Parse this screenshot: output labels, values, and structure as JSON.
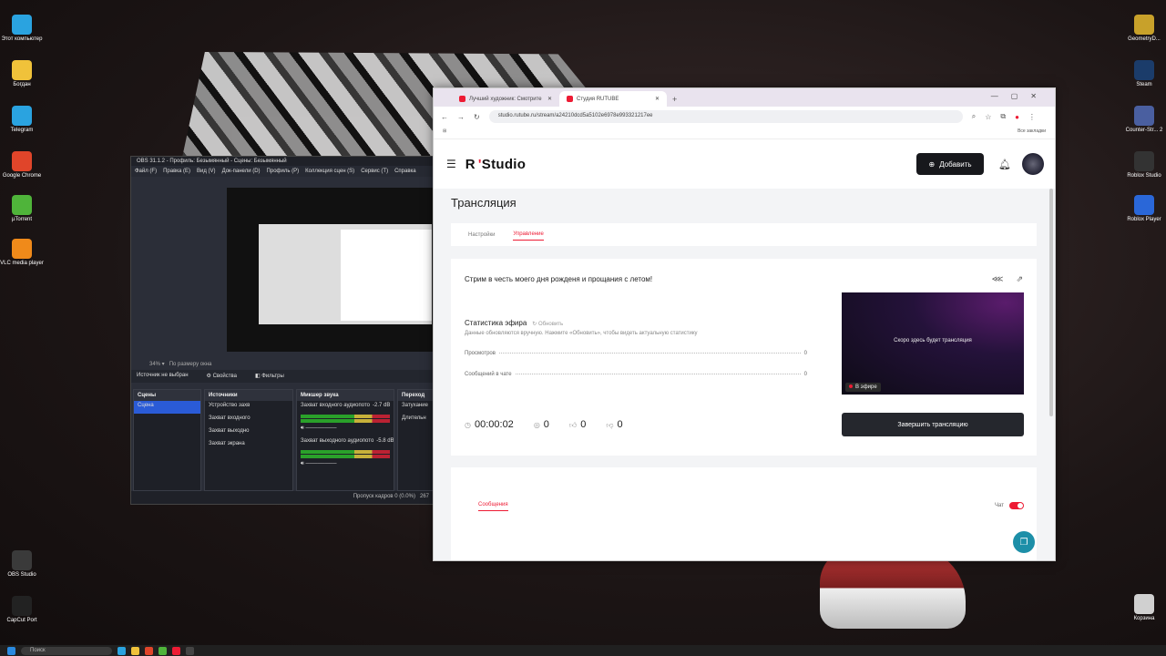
{
  "desktop": {
    "left_icons": [
      {
        "label": "Этот компьютер",
        "color": "#2aa3e0"
      },
      {
        "label": "Богдан",
        "color": "#f0c23a"
      },
      {
        "label": "Telegram",
        "color": "#2aa3e0"
      },
      {
        "label": "Google Chrome",
        "color": "#e0452a"
      },
      {
        "label": "µTorrent",
        "color": "#4fb43a"
      },
      {
        "label": "VLC media player",
        "color": "#f08a1a"
      },
      {
        "label": "OBS Studio",
        "color": "#3a3a3a"
      },
      {
        "label": "CapCut Port",
        "color": "#222222"
      }
    ],
    "right_icons": [
      {
        "label": "GeometryD...",
        "color": "#c8a12a"
      },
      {
        "label": "Steam",
        "color": "#1b3c6a"
      },
      {
        "label": "Counter-Str... 2",
        "color": "#4a5fa0"
      },
      {
        "label": "Roblox Studio",
        "color": "#333333"
      },
      {
        "label": "Roblox Player",
        "color": "#2a67d8"
      },
      {
        "label": "Корзина",
        "color": "#d0d0d0"
      }
    ]
  },
  "taskbar": {
    "search": "Поиск"
  },
  "obs": {
    "title": "OBS 31.1.2 - Профиль: Безымянный - Сцены: Безымянный",
    "menu": [
      "Файл (F)",
      "Правка (E)",
      "Вид (V)",
      "Док-панели (D)",
      "Профиль (P)",
      "Коллекция сцен (S)",
      "Сервис (T)",
      "Справка"
    ],
    "zoom": "34%",
    "fit": "По размеру окна",
    "no_source": "Источник не выбран",
    "properties": "Свойства",
    "filters": "Фильтры",
    "scenes_title": "Сцены",
    "scene": "Сцена",
    "sources_title": "Источники",
    "sources": [
      "Устройство захв",
      "Захват входного",
      "Захват выходно",
      "Захват экрана"
    ],
    "mixer_title": "Микшер звука",
    "mixer": [
      {
        "name": "Захват входного аудиопото",
        "db": "-2.7 dB"
      },
      {
        "name": "Захват выходного аудиопото",
        "db": "-5.8 dB"
      }
    ],
    "transitions_title": "Переход",
    "transition": "Затухание",
    "duration": "Длительн",
    "status": "Пропуск кадров 0 (0.0%)",
    "bitrate": "267"
  },
  "browser": {
    "tabs": [
      {
        "title": "Лучший художник: Смотрите"
      },
      {
        "title": "Студия RUTUBE"
      }
    ],
    "url": "studio.rutube.ru/stream/a24210dcd5a5102e6978e993321217ee",
    "bookmarks_all": "Все закладки"
  },
  "app": {
    "logo_r": "R",
    "logo_studio": "Studio",
    "add_button": "Добавить",
    "page_title": "Трансляция",
    "tab_settings": "Настройки",
    "tab_manage": "Управление",
    "stream_title": "Стрим в честь моего дня рожденя и прощания с летом!",
    "stats_title": "Статистика эфира",
    "refresh": "Обновить",
    "stats_hint": "Данные обновляются вручную. Нажмите «Обновить», чтобы видеть актуальную статистику",
    "rows": [
      {
        "label": "Просмотров",
        "value": "0"
      },
      {
        "label": "Сообщений в чате",
        "value": "0"
      }
    ],
    "timer": "00:00:02",
    "viewers": "0",
    "likes": "0",
    "dislikes": "0",
    "player_soon": "Скоро здесь будет трансляция",
    "live_badge": "В эфире",
    "end_button": "Завершить трансляцию",
    "messages_tab": "Сообщения",
    "chat_label": "Чат"
  },
  "colors": {
    "accent": "#ed1b34",
    "dark": "#17181c"
  }
}
